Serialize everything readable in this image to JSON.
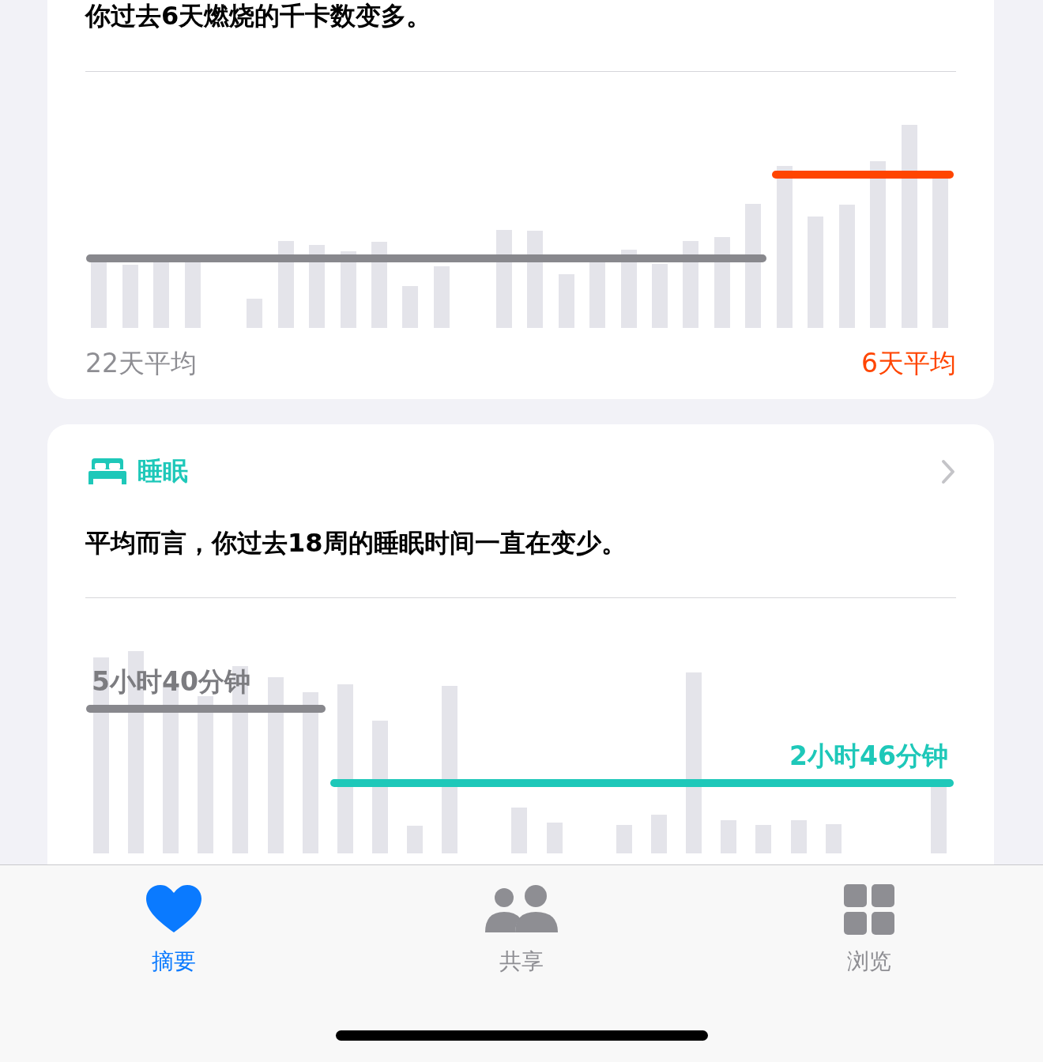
{
  "calories_card": {
    "summary": "你过去6天燃烧的千卡数变多。",
    "baseline_label": "22天平均",
    "recent_label": "6天平均"
  },
  "sleep_card": {
    "title": "睡眠",
    "summary": "平均而言，你过去18周的睡眠时间一直在变少。",
    "baseline_value": "5小时40分钟",
    "recent_value": "2小时46分钟"
  },
  "tab_bar": [
    {
      "label": "摘要",
      "kind": "heart",
      "selected": true
    },
    {
      "label": "共享",
      "kind": "people",
      "selected": false
    },
    {
      "label": "浏览",
      "kind": "grid",
      "selected": false
    }
  ]
}
